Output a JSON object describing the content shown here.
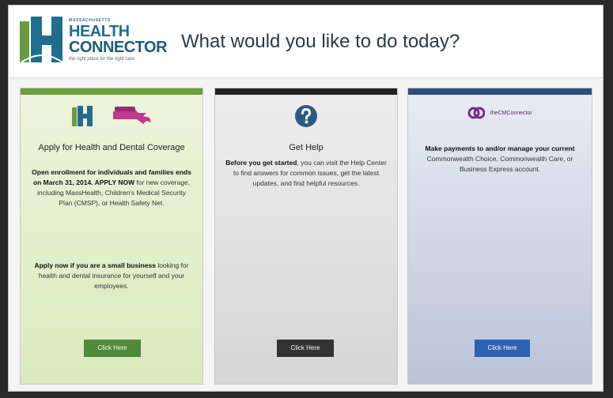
{
  "header": {
    "logo_small": "MASSACHUSETTS",
    "logo_health": "HEALTH",
    "logo_connector": "CONNECTOR",
    "logo_tagline": "the right place for the right care",
    "headline": "What would you like to do today?"
  },
  "columns": {
    "coverage": {
      "title": "Apply for Health and Dental Coverage",
      "p1_bold": "Open enrollment for individuals and families ends on March 31, 2014. APPLY NOW",
      "p1_rest": " for new coverage, including MassHealth, Children's Medical Security Plan (CMSP), or Health Safety Net.",
      "p2_bold": "Apply now if you are a small business",
      "p2_rest": " looking for health and dental insurance for yourself and your employees.",
      "button": "Click Here"
    },
    "help": {
      "title": "Get Help",
      "p1_bold": "Before you get started",
      "p1_rest": ", you can visit the Help Center to find answers for common issues, get the latest updates, and find helpful resources.",
      "button": "Click Here"
    },
    "payments": {
      "brand": "theCMConnector",
      "p1_bold": "Make payments to and/or manage your current",
      "p1_rest": " Commonwealth Choice, Commonwealth Care, or Business Express account.",
      "button": "Click Here"
    }
  },
  "colors": {
    "green": "#6b9d3a",
    "dark": "#222222",
    "blue": "#2d4f7f",
    "brand": "#1f6d8f"
  },
  "icons": {
    "logo": "health-connector-logo",
    "coverage_left": "health-connector-h-icon",
    "coverage_right": "massachusetts-map-icon",
    "help": "question-circle-icon",
    "payments": "chain-link-icon"
  }
}
